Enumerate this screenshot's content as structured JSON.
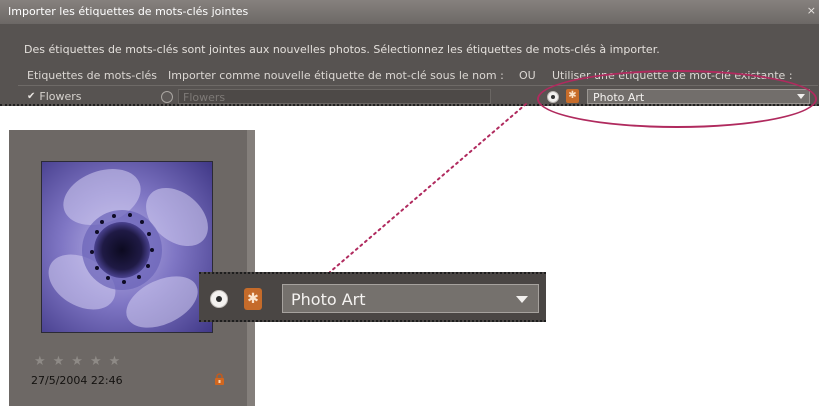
{
  "dialog": {
    "title": "Importer les étiquettes de mots-clés jointes",
    "close_glyph": "×",
    "description": "Des étiquettes de mots-clés sont jointes aux nouvelles photos. Sélectionnez les étiquettes de mots-clés à importer.",
    "headers": {
      "keywords": "Etiquettes de mots-clés",
      "import_as": "Importer comme nouvelle étiquette de mot-clé sous le nom :",
      "or": "OU",
      "use_existing": "Utiliser une étiquette de mot-clé existante :"
    },
    "row": {
      "keyword": "Flowers",
      "checked": true,
      "new_name_placeholder": "Flowers",
      "existing_tag": "Photo Art"
    }
  },
  "photo_card": {
    "rating_glyphs": "★★★★★",
    "rating": 0,
    "date": "27/5/2004 22:46"
  },
  "zoom": {
    "existing_tag": "Photo Art"
  },
  "colors": {
    "highlight": "#b02a5e",
    "tag_icon": "#c76c2a",
    "dialog_bg": "#575351"
  },
  "icons": {
    "checkbox": "check-icon",
    "tag": "keyword-tag-icon",
    "lock": "lock-icon",
    "dropdown": "chevron-down-icon"
  }
}
